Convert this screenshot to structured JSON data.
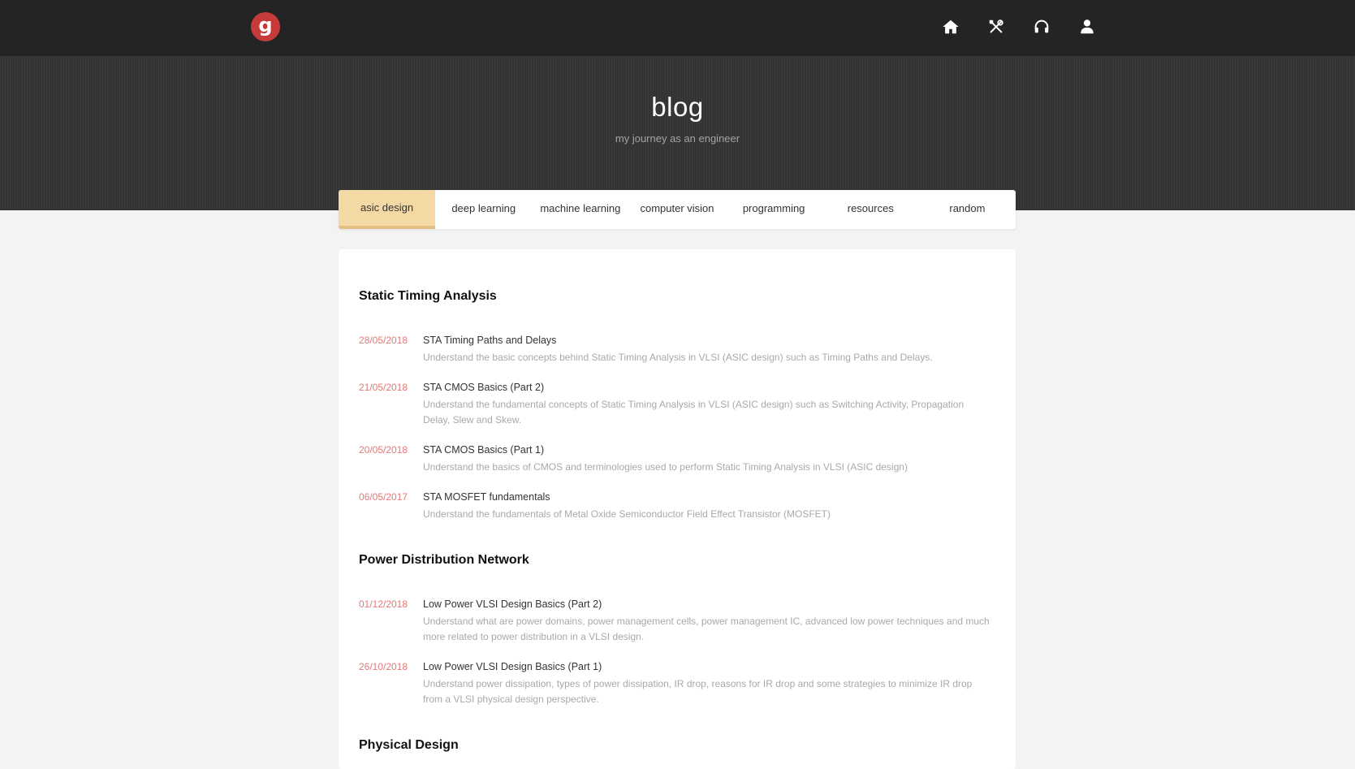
{
  "nav": {
    "logo_letter": "g",
    "icons": [
      "home-icon",
      "tools-icon",
      "headphones-icon",
      "user-icon"
    ]
  },
  "hero": {
    "title": "blog",
    "subtitle": "my journey as an engineer"
  },
  "tabs": [
    {
      "label": "asic design",
      "active": true
    },
    {
      "label": "deep learning",
      "active": false
    },
    {
      "label": "machine learning",
      "active": false
    },
    {
      "label": "computer vision",
      "active": false
    },
    {
      "label": "programming",
      "active": false
    },
    {
      "label": "resources",
      "active": false
    },
    {
      "label": "random",
      "active": false
    }
  ],
  "sections": [
    {
      "title": "Static Timing Analysis",
      "posts": [
        {
          "date": "28/05/2018",
          "title": "STA Timing Paths and Delays",
          "desc": "Understand the basic concepts behind Static Timing Analysis in VLSI (ASIC design) such as Timing Paths and Delays."
        },
        {
          "date": "21/05/2018",
          "title": "STA CMOS Basics (Part 2)",
          "desc": "Understand the fundamental concepts of Static Timing Analysis in VLSI (ASIC design) such as Switching Activity, Propagation Delay, Slew and Skew."
        },
        {
          "date": "20/05/2018",
          "title": "STA CMOS Basics (Part 1)",
          "desc": "Understand the basics of CMOS and terminologies used to perform Static Timing Analysis in VLSI (ASIC design)"
        },
        {
          "date": "06/05/2017",
          "title": "STA MOSFET fundamentals",
          "desc": "Understand the fundamentals of Metal Oxide Semiconductor Field Effect Transistor (MOSFET)"
        }
      ]
    },
    {
      "title": "Power Distribution Network",
      "posts": [
        {
          "date": "01/12/2018",
          "title": "Low Power VLSI Design Basics (Part 2)",
          "desc": "Understand what are power domains, power management cells, power management IC, advanced low power techniques and much more related to power distribution in a VLSI design."
        },
        {
          "date": "26/10/2018",
          "title": "Low Power VLSI Design Basics (Part 1)",
          "desc": "Understand power dissipation, types of power dissipation, IR drop, reasons for IR drop and some strategies to minimize IR drop from a VLSI physical design perspective."
        }
      ]
    },
    {
      "title": "Physical Design",
      "posts": []
    }
  ],
  "colors": {
    "topbar": "#242424",
    "logo": "#c73a3a",
    "active_tab": "#f4d9a5",
    "date": "#e07a7a"
  }
}
